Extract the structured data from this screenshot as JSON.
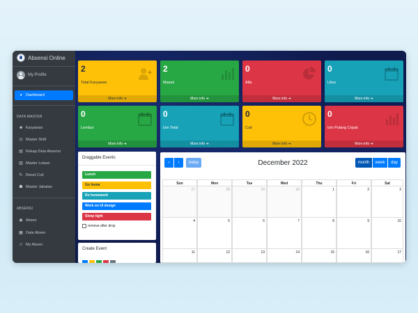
{
  "brand": {
    "title": "Absensi Online"
  },
  "user": {
    "name": "My Profile"
  },
  "sidebar": {
    "dashboard": "Dashboard",
    "header_master": "DATA MASTER",
    "master_items": [
      "Karyawan",
      "Master Shift",
      "Rekap Data Absensi",
      "Master Lokasi",
      "Reset Cuti",
      "Master Jabatan"
    ],
    "header_absensi": "ABSENSI",
    "absensi_items": [
      "Absen",
      "Data Absen",
      "My Absen"
    ]
  },
  "boxes": [
    {
      "value": "2",
      "label": "Total Karyawan",
      "footer": "More info ➜",
      "color": "#ffc107",
      "icon": "user-plus-icon"
    },
    {
      "value": "2",
      "label": "Masuk",
      "footer": "More info ➜",
      "color": "#28a745",
      "icon": "bar-chart-icon"
    },
    {
      "value": "0",
      "label": "Alfa",
      "footer": "More info ➜",
      "color": "#dc3545",
      "icon": "pie-chart-icon"
    },
    {
      "value": "0",
      "label": "Libur",
      "footer": "More info ➜",
      "color": "#17a2b8",
      "icon": "calendar-icon"
    },
    {
      "value": "0",
      "label": "Lembur",
      "footer": "More info ➜",
      "color": "#28a745",
      "icon": "calendar-icon"
    },
    {
      "value": "0",
      "label": "Izin Telat",
      "footer": "More info ➜",
      "color": "#17a2b8",
      "icon": "calendar-icon"
    },
    {
      "value": "0",
      "label": "Cuti",
      "footer": "More info ➜",
      "color": "#ffc107",
      "icon": "clock-icon"
    },
    {
      "value": "0",
      "label": "Izin Pulang Cepat",
      "footer": "More info ➜",
      "color": "#dc3545",
      "icon": "bar-chart-icon"
    }
  ],
  "draggable": {
    "title": "Draggable Events",
    "events": [
      {
        "label": "Lunch",
        "color": "#28a745",
        "text_color": "#ffffff"
      },
      {
        "label": "Go home",
        "color": "#ffc107",
        "text_color": "#1f2d3d"
      },
      {
        "label": "Do homework",
        "color": "#17a2b8",
        "text_color": "#ffffff"
      },
      {
        "label": "Work on UI design",
        "color": "#007bff",
        "text_color": "#ffffff"
      },
      {
        "label": "Sleep tight",
        "color": "#dc3545",
        "text_color": "#ffffff"
      }
    ],
    "remove_label": "remove after drop"
  },
  "create_event": {
    "title": "Create Event",
    "swatches": [
      "#007bff",
      "#ffc107",
      "#28a745",
      "#dc3545",
      "#6c757d"
    ]
  },
  "calendar": {
    "prev": "‹",
    "next": "›",
    "today": "today",
    "title": "December 2022",
    "views": [
      "month",
      "week",
      "day"
    ],
    "weekdays": [
      "Sun",
      "Mon",
      "Tue",
      "Wed",
      "Thu",
      "Fri",
      "Sat"
    ],
    "weeks": [
      [
        {
          "d": "27",
          "o": true
        },
        {
          "d": "28",
          "o": true
        },
        {
          "d": "29",
          "o": true
        },
        {
          "d": "30",
          "o": true
        },
        {
          "d": "1",
          "o": false
        },
        {
          "d": "2",
          "o": false
        },
        {
          "d": "3",
          "o": false
        }
      ],
      [
        {
          "d": "4",
          "o": false
        },
        {
          "d": "5",
          "o": false
        },
        {
          "d": "6",
          "o": false
        },
        {
          "d": "7",
          "o": false
        },
        {
          "d": "8",
          "o": false
        },
        {
          "d": "9",
          "o": false
        },
        {
          "d": "10",
          "o": false
        }
      ],
      [
        {
          "d": "11",
          "o": false
        },
        {
          "d": "12",
          "o": false
        },
        {
          "d": "13",
          "o": false
        },
        {
          "d": "14",
          "o": false
        },
        {
          "d": "15",
          "o": false
        },
        {
          "d": "16",
          "o": false
        },
        {
          "d": "17",
          "o": false
        }
      ]
    ]
  }
}
